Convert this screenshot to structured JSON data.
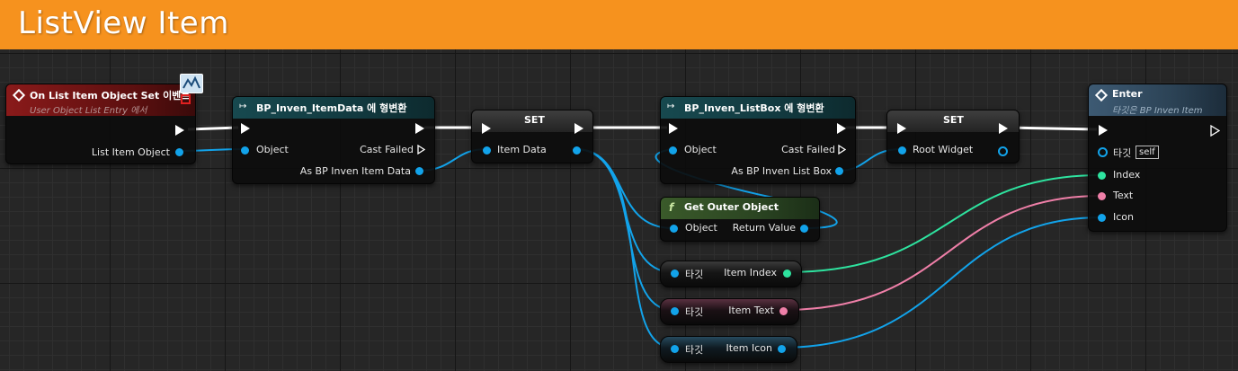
{
  "title": "ListView Item",
  "nodes": {
    "event": {
      "title": "On List Item Object Set 이벤트",
      "subtitle": "User Object List Entry 에서",
      "pin_out": "List Item Object"
    },
    "cast1": {
      "title": "BP_Inven_ItemData 에 형변환",
      "pin_in": "Object",
      "pin_failed": "Cast Failed",
      "pin_out": "As BP Inven Item Data"
    },
    "set1": {
      "title": "SET",
      "pin": "Item Data"
    },
    "cast2": {
      "title": "BP_Inven_ListBox 에 형변환",
      "pin_in": "Object",
      "pin_failed": "Cast Failed",
      "pin_out": "As BP Inven List Box"
    },
    "set2": {
      "title": "SET",
      "pin": "Root Widget"
    },
    "enter": {
      "title": "Enter",
      "subtitle": "타깃은 BP Inven Item",
      "target_label": "타깃",
      "target_value": "self",
      "pins": [
        "Index",
        "Text",
        "Icon"
      ]
    },
    "get_outer": {
      "title": "Get Outer Object",
      "pin_in": "Object",
      "pin_out": "Return Value"
    },
    "get_index": {
      "target": "타깃",
      "out": "Item Index"
    },
    "get_text": {
      "target": "타깃",
      "out": "Item Text"
    },
    "get_icon": {
      "target": "타깃",
      "out": "Item Icon"
    }
  },
  "colors": {
    "title_bar": "#f6921e",
    "event_header": "#8a1a1a",
    "cast_header": "#17494f",
    "function_header": "#3a5a2a",
    "enter_header": "#3d5a73",
    "object_pin": "#12a3ea",
    "int_pin": "#2ee39f",
    "text_pin": "#ef7fa8"
  },
  "icons": {
    "event": "event-diamond-icon",
    "cast": "cast-arrow-icon",
    "function": "function-f-icon",
    "delegate": "delegate-square-icon"
  }
}
